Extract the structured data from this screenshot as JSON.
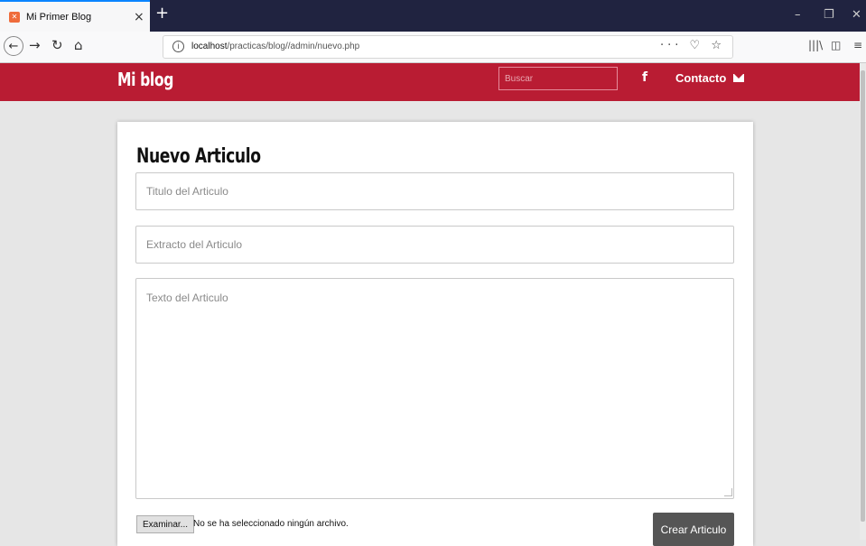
{
  "browser": {
    "tab_title": "Mi Primer Blog",
    "tab_close": "×",
    "new_tab": "+",
    "url_host": "localhost",
    "url_path": "/practicas/blog//admin/nuevo.php",
    "url_actions": "··· ♡ ☆"
  },
  "header": {
    "brand": "Mi blog",
    "search_placeholder": "Buscar",
    "facebook": "f",
    "contact_label": "Contacto"
  },
  "form": {
    "title": "Nuevo Articulo",
    "title_placeholder": "Titulo del Articulo",
    "excerpt_placeholder": "Extracto del Articulo",
    "body_placeholder": "Texto del Articulo",
    "file_button": "Examinar...",
    "file_status": "No se ha seleccionado ningún archivo.",
    "submit_label": "Crear Articulo"
  },
  "colors": {
    "header_bg": "#b91c33",
    "tabbar_bg": "#202340",
    "submit_bg": "#555555"
  }
}
